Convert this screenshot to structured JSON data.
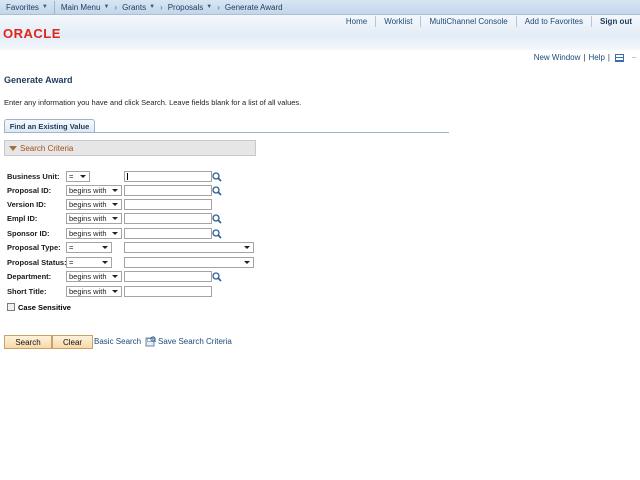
{
  "nav": {
    "favorites": "Favorites",
    "main_menu": "Main Menu",
    "crumbs": [
      "Grants",
      "Proposals",
      "Generate Award"
    ],
    "separator": "›"
  },
  "header": {
    "logo": "ORACLE",
    "links": [
      "Home",
      "Worklist",
      "MultiChannel Console",
      "Add to Favorites",
      "Sign out"
    ]
  },
  "utility": {
    "new_window": "New Window",
    "separator": "|",
    "help": "Help"
  },
  "page": {
    "title": "Generate Award",
    "instructions": "Enter any information you have and click Search. Leave fields blank for a list of all values."
  },
  "tab": {
    "label": "Find an Existing Value"
  },
  "criteria": {
    "label": "Search Criteria"
  },
  "fields": [
    {
      "label": "Business Unit:",
      "operator": "=",
      "value": "",
      "lookup": true,
      "type": "text"
    },
    {
      "label": "Proposal ID:",
      "operator": "begins with",
      "value": "",
      "lookup": true,
      "type": "text"
    },
    {
      "label": "Version ID:",
      "operator": "begins with",
      "value": "",
      "lookup": false,
      "type": "text"
    },
    {
      "label": "Empl ID:",
      "operator": "begins with",
      "value": "",
      "lookup": true,
      "type": "text"
    },
    {
      "label": "Sponsor ID:",
      "operator": "begins with",
      "value": "",
      "lookup": true,
      "type": "text"
    },
    {
      "label": "Proposal Type:",
      "operator": "=",
      "value": "",
      "lookup": false,
      "type": "select"
    },
    {
      "label": "Proposal Status:",
      "operator": "=",
      "value": "",
      "lookup": false,
      "type": "select"
    },
    {
      "label": "Department:",
      "operator": "begins with",
      "value": "",
      "lookup": true,
      "type": "text"
    },
    {
      "label": "Short Title:",
      "operator": "begins with",
      "value": "",
      "lookup": false,
      "type": "text"
    }
  ],
  "case_sensitive": {
    "label": "Case Sensitive",
    "checked": false
  },
  "buttons": {
    "search": "Search",
    "clear": "Clear"
  },
  "links": {
    "basic_search": "Basic Search",
    "save_search": "Save Search Criteria"
  },
  "colors": {
    "oracle_red": "#e2231a",
    "link_blue": "#1c4a7a",
    "button_fill": "#f7d9a8"
  }
}
